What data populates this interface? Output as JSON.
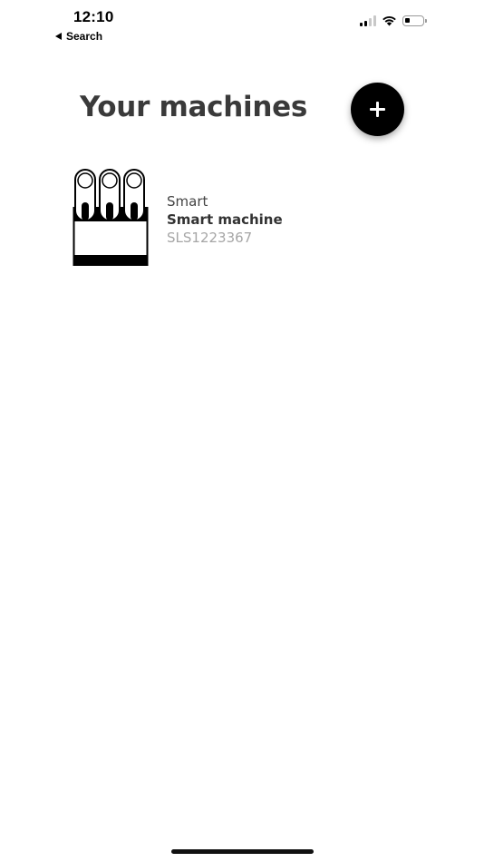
{
  "status_bar": {
    "time": "12:10",
    "back_label": "Search",
    "battery_level": 0.3
  },
  "header": {
    "title": "Your machines",
    "add_button_icon": "plus-icon"
  },
  "machines": [
    {
      "brand": "Smart",
      "name": "Smart machine",
      "serial": "SLS1223367",
      "icon": "machine-illustration-icon"
    }
  ],
  "colors": {
    "accent": "#000000",
    "background": "#ffffff",
    "title": "#3a3a3a",
    "muted": "#a6a6a6"
  }
}
